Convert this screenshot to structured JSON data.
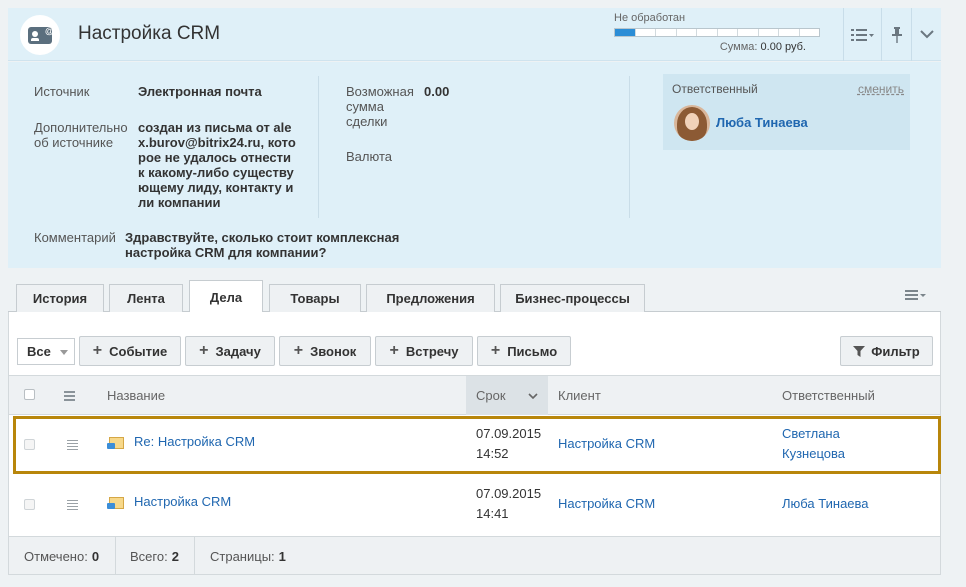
{
  "header": {
    "title": "Настройка CRM",
    "status_label": "Не обработан",
    "status_segments_total": 10,
    "status_segments_filled": 1,
    "sum_label": "Сумма:",
    "sum_value": "0.00 руб.",
    "icons": [
      "crm-lead-icon",
      "list-settings-icon",
      "pin-icon",
      "collapse-chevron-icon"
    ]
  },
  "info": {
    "source_label": "Источник",
    "source_value": "Электронная почта",
    "source_extra_label_1": "Дополнительно",
    "source_extra_label_2": "об источнике",
    "source_extra_lines": [
      "создан из письма от ale",
      "x.burov@bitrix24.ru, кото",
      "рое не удалось отнести",
      "к какому-либо существу",
      "ющему лиду, контакту и",
      "ли компании"
    ],
    "amount_label_lines": [
      "Возможная",
      "сумма",
      "сделки"
    ],
    "amount_value": "0.00",
    "currency_label": "Валюта",
    "comment_label": "Комментарий",
    "comment_lines": [
      "Здравствуйте, сколько стоит комплексная",
      "настройка CRM для компании?"
    ],
    "responsible": {
      "title": "Ответственный",
      "change": "сменить",
      "name": "Люба Тинаева"
    }
  },
  "tabs": [
    "История",
    "Лента",
    "Дела",
    "Товары",
    "Предложения",
    "Бизнес-процессы"
  ],
  "active_tab": "Дела",
  "toolbar": {
    "filter_select": "Все",
    "buttons": [
      "Событие",
      "Задачу",
      "Звонок",
      "Встречу",
      "Письмо"
    ],
    "filter_button": "Фильтр"
  },
  "table": {
    "columns": [
      "Название",
      "Срок",
      "Клиент",
      "Ответственный"
    ],
    "rows": [
      {
        "title": "Re: Настройка CRM",
        "date": "07.09.2015",
        "time": "14:52",
        "client": "Настройка CRM",
        "responsible_1": "Светлана",
        "responsible_2": "Кузнецова"
      },
      {
        "title": "Настройка CRM",
        "date": "07.09.2015",
        "time": "14:41",
        "client": "Настройка CRM",
        "responsible_1": "Люба Тинаева",
        "responsible_2": ""
      }
    ]
  },
  "footer": {
    "selected_label": "Отмечено:",
    "selected_value": "0",
    "total_label": "Всего:",
    "total_value": "2",
    "pages_label": "Страницы:",
    "pages_value": "1"
  },
  "colors": {
    "accent": "#2b8dd6",
    "link": "#2067b0",
    "panel": "#dff0f8",
    "highlight_border": "#b8860b"
  }
}
